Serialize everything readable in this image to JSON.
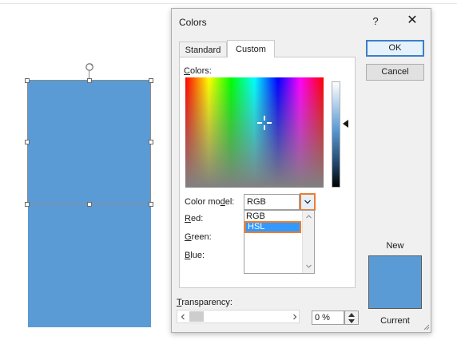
{
  "dialog": {
    "title": "Colors",
    "help_glyph": "?",
    "close_glyph": "✕"
  },
  "tabs": [
    {
      "label": "Standard",
      "selected": false
    },
    {
      "label": "Custom",
      "selected": true
    }
  ],
  "custom": {
    "colors_label_accel": "C",
    "colors_label_rest": "olors:",
    "color_model_label_pre": "Color mo",
    "color_model_label_accel": "d",
    "color_model_label_post": "el:",
    "color_model_value": "RGB",
    "color_model_options": [
      {
        "label": "RGB",
        "highlighted": false
      },
      {
        "label": "HSL",
        "highlighted": true
      }
    ],
    "red_label_accel": "R",
    "red_label_rest": "ed:",
    "green_label_accel": "G",
    "green_label_rest": "reen:",
    "blue_label_accel": "B",
    "blue_label_rest": "lue:"
  },
  "buttons": {
    "ok": "OK",
    "cancel": "Cancel"
  },
  "preview": {
    "new_label": "New",
    "current_label": "Current",
    "color": "#5b9bd5"
  },
  "transparency": {
    "label_accel": "T",
    "label_rest": "ransparency:",
    "value": "0 %"
  },
  "colors": {
    "shape_fill": "#5b9bd5",
    "accent_highlight": "#ed7d31",
    "selection": "#3399ff"
  },
  "icons": {
    "dropdown": "chevron-down-icon",
    "scroll_left": "arrow-left-icon",
    "scroll_right": "arrow-right-icon"
  }
}
